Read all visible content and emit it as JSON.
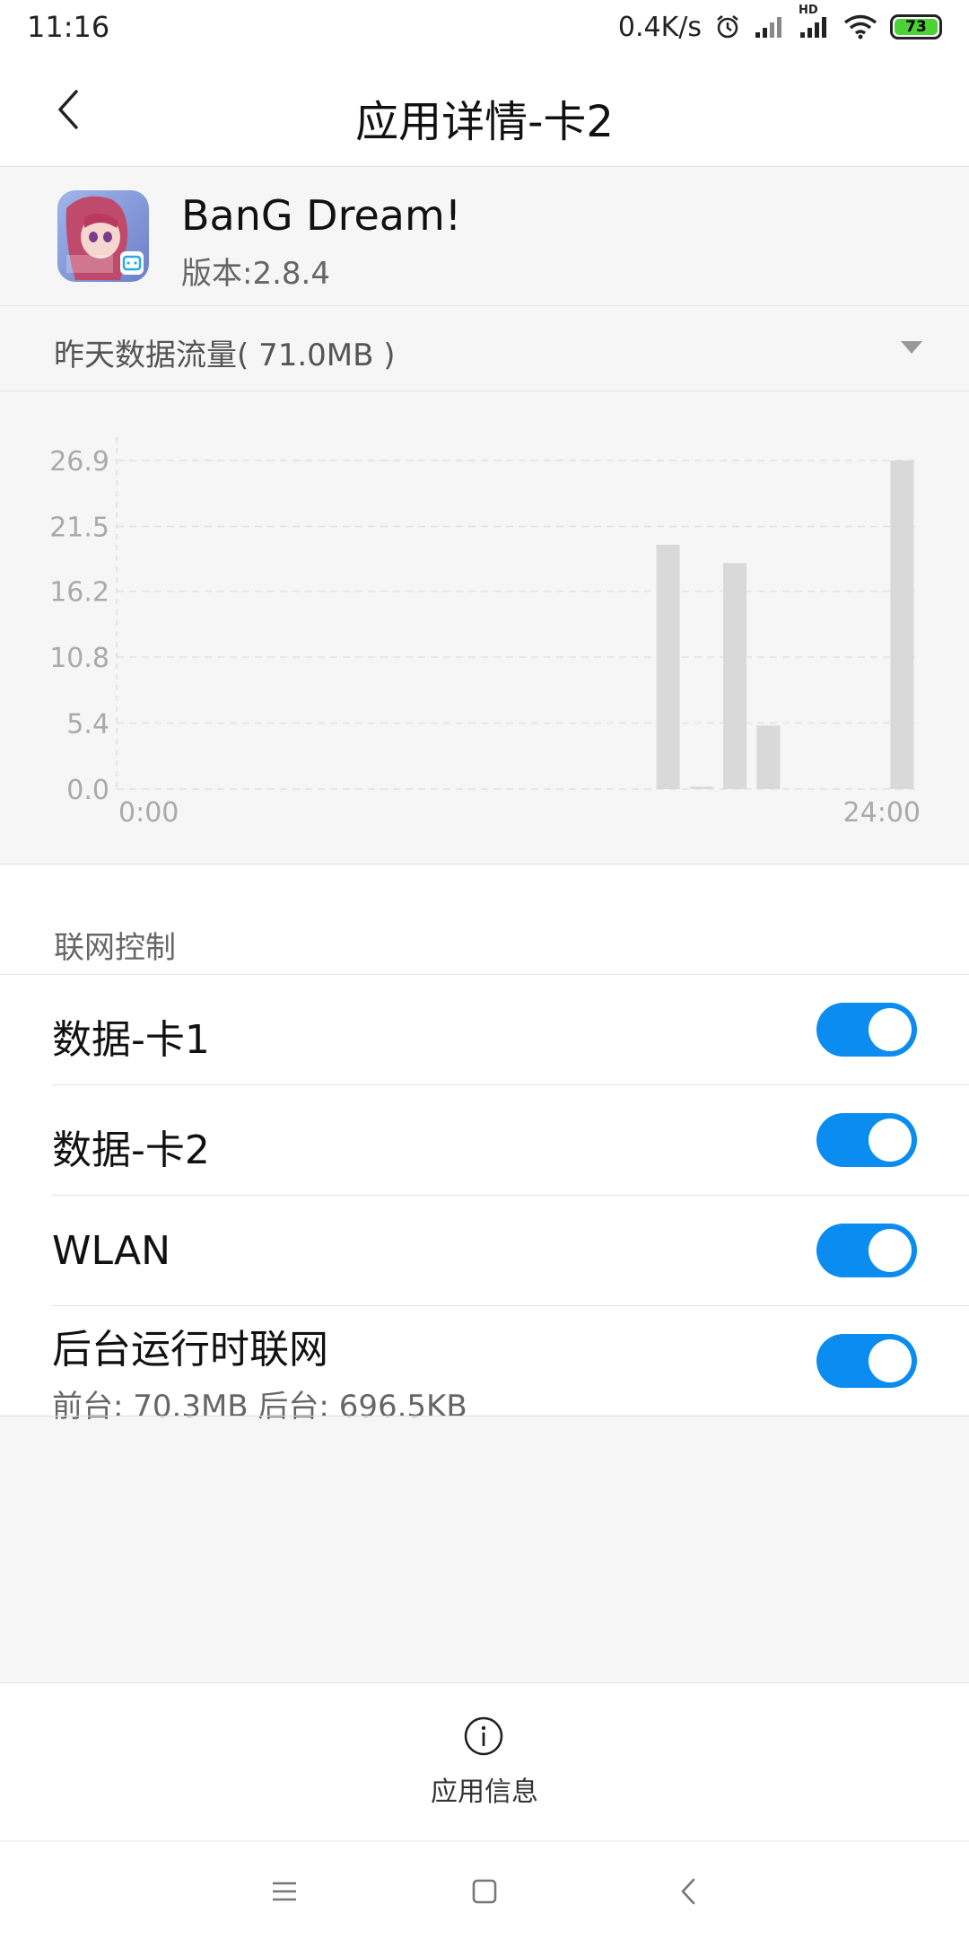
{
  "status_bar": {
    "time": "11:16",
    "net_speed": "0.4K/s",
    "hd_label": "HD",
    "battery_level": "73",
    "icons": [
      "alarm-icon",
      "signal-icon",
      "signal-hd-icon",
      "wifi-icon",
      "battery-icon"
    ]
  },
  "header": {
    "title": "应用详情-卡2",
    "back_icon": "chevron-left-icon"
  },
  "app": {
    "name": "BanG Dream!",
    "version": "版本:2.8.4",
    "icon": "app-icon-bang-dream"
  },
  "period": {
    "label": "昨天数据流量( 71.0MB )",
    "dropdown_icon": "triangle-down-icon"
  },
  "chart_data": {
    "type": "bar",
    "title": "",
    "xlabel": "",
    "ylabel": "",
    "y_ticks": [
      "26.9",
      "21.5",
      "16.2",
      "10.8",
      "5.4",
      "0.0"
    ],
    "x_tick_labels": [
      "0:00",
      "24:00"
    ],
    "ylim": [
      0,
      26.9
    ],
    "xlim": [
      0,
      24
    ],
    "grid": true,
    "bar_color": "#d9d9d9",
    "x": [
      16.5,
      17.5,
      18.5,
      19.5,
      23.5
    ],
    "values": [
      20.0,
      0.2,
      18.5,
      5.2,
      26.9
    ]
  },
  "network_control": {
    "section_title": "联网控制",
    "rows": [
      {
        "label": "数据-卡1",
        "enabled": true
      },
      {
        "label": "数据-卡2",
        "enabled": true
      },
      {
        "label": "WLAN",
        "enabled": true
      },
      {
        "label": "后台运行时联网",
        "sublabel": "前台: 70.3MB  后台: 696.5KB",
        "enabled": true
      }
    ],
    "toggle_color": "#0a8cf0"
  },
  "bottom_action": {
    "label": "应用信息",
    "icon": "info-icon"
  },
  "nav_bar": {
    "icons": [
      "menu-icon",
      "home-icon",
      "back-icon"
    ]
  }
}
